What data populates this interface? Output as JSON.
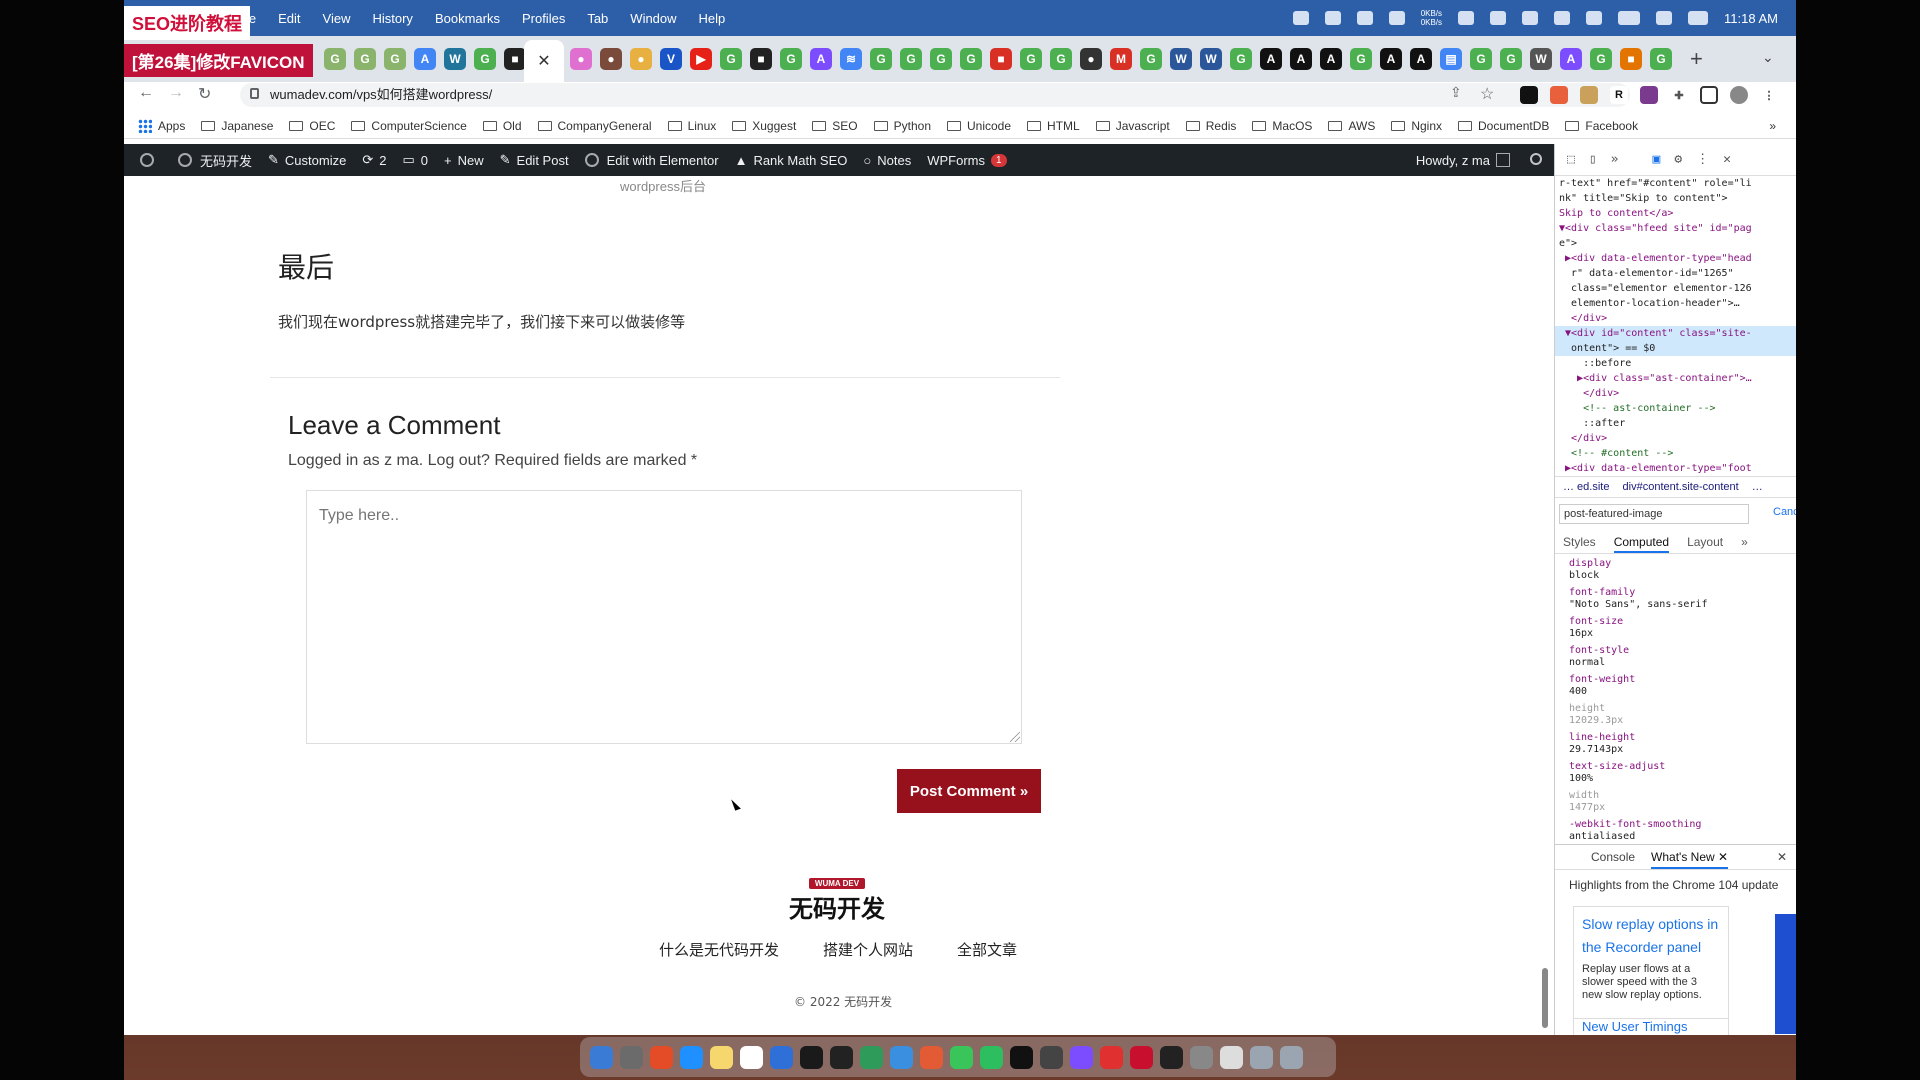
{
  "overlay": {
    "line1": "SEO进阶教程",
    "line2": "[第26集]修改FAVICON"
  },
  "menubar": {
    "items": [
      "le",
      "Edit",
      "View",
      "History",
      "Bookmarks",
      "Profiles",
      "Tab",
      "Window",
      "Help"
    ],
    "net_up": "0KB/s",
    "net_down": "0KB/s",
    "clock": "11:18 AM"
  },
  "tabs": {
    "close_glyph": "✕",
    "new_tab": "+",
    "menu": "⌄",
    "icons": [
      {
        "glyph": "G",
        "color": "#8ab36b"
      },
      {
        "glyph": "G",
        "color": "#8ab36b"
      },
      {
        "glyph": "G",
        "color": "#8ab36b"
      },
      {
        "glyph": "A",
        "color": "#4285f4"
      },
      {
        "glyph": "W",
        "color": "#21759b"
      },
      {
        "glyph": "G",
        "color": "#4caf50"
      },
      {
        "glyph": "■",
        "color": "#222"
      }
    ],
    "icons_right": [
      {
        "glyph": "●",
        "color": "#e070d0"
      },
      {
        "glyph": "●",
        "color": "#7a4a3a"
      },
      {
        "glyph": "●",
        "color": "#e8b040"
      },
      {
        "glyph": "V",
        "color": "#1a55c8"
      },
      {
        "glyph": "▶",
        "color": "#e62117"
      },
      {
        "glyph": "G",
        "color": "#4caf50"
      },
      {
        "glyph": "■",
        "color": "#222"
      },
      {
        "glyph": "G",
        "color": "#4caf50"
      },
      {
        "glyph": "A",
        "color": "#7c4dff"
      },
      {
        "glyph": "≋",
        "color": "#4285f4"
      },
      {
        "glyph": "G",
        "color": "#4caf50"
      },
      {
        "glyph": "G",
        "color": "#4caf50"
      },
      {
        "glyph": "G",
        "color": "#4caf50"
      },
      {
        "glyph": "G",
        "color": "#4caf50"
      },
      {
        "glyph": "■",
        "color": "#d93025"
      },
      {
        "glyph": "G",
        "color": "#4caf50"
      },
      {
        "glyph": "G",
        "color": "#4caf50"
      },
      {
        "glyph": "●",
        "color": "#333"
      },
      {
        "glyph": "M",
        "color": "#d93025"
      },
      {
        "glyph": "G",
        "color": "#4caf50"
      },
      {
        "glyph": "W",
        "color": "#2b579a"
      },
      {
        "glyph": "W",
        "color": "#2b579a"
      },
      {
        "glyph": "G",
        "color": "#4caf50"
      },
      {
        "glyph": "A",
        "color": "#111"
      },
      {
        "glyph": "A",
        "color": "#111"
      },
      {
        "glyph": "A",
        "color": "#111"
      },
      {
        "glyph": "G",
        "color": "#4caf50"
      },
      {
        "glyph": "A",
        "color": "#111"
      },
      {
        "glyph": "A",
        "color": "#111"
      },
      {
        "glyph": "▤",
        "color": "#4285f4"
      },
      {
        "glyph": "G",
        "color": "#4caf50"
      },
      {
        "glyph": "G",
        "color": "#4caf50"
      },
      {
        "glyph": "W",
        "color": "#555"
      },
      {
        "glyph": "A",
        "color": "#7c4dff"
      },
      {
        "glyph": "G",
        "color": "#4caf50"
      },
      {
        "glyph": "■",
        "color": "#e37400"
      },
      {
        "glyph": "G",
        "color": "#4caf50"
      }
    ]
  },
  "addressbar": {
    "back": "←",
    "forward": "→",
    "reload": "↻",
    "url": "wumadev.com/vps如何搭建wordpress/",
    "share": "⇪",
    "star": "☆",
    "ext_r": "R",
    "ext_puzzle": "✚",
    "ext_menu": "⋮"
  },
  "bookmarks": {
    "apps": "Apps",
    "folders": [
      "Japanese",
      "OEC",
      "ComputerScience",
      "Old",
      "CompanyGeneral",
      "Linux",
      "Xuggest",
      "SEO",
      "Python",
      "Unicode",
      "HTML",
      "Javascript",
      "Redis",
      "MacOS",
      "AWS",
      "Nginx",
      "DocumentDB",
      "Facebook"
    ],
    "more": "»"
  },
  "wpbar": {
    "site_name": "无码开发",
    "customize": "Customize",
    "updates_count": "2",
    "comments_count": "0",
    "new": "New",
    "edit_post": "Edit Post",
    "edit_elementor": "Edit with Elementor",
    "rank_math": "Rank Math SEO",
    "notes": "Notes",
    "wpforms": "WPForms",
    "wpforms_badge": "1",
    "howdy": "Howdy, z ma"
  },
  "article": {
    "caption_cut": "wordpress后台",
    "heading": "最后",
    "body": "我们现在wordpress就搭建完毕了，我们接下来可以做装修等"
  },
  "comments": {
    "title": "Leave a Comment",
    "logged_in": "Logged in as z ma. Log out? Required fields are marked *",
    "placeholder": "Type here..",
    "submit": "Post Comment »"
  },
  "footer": {
    "logo_tag": "WUMA DEV",
    "logo_text": "无码开发",
    "nav": [
      "什么是无代码开发",
      "搭建个人网站",
      "全部文章"
    ],
    "copyright": "© 2022 无码开发"
  },
  "devtools": {
    "dom_lines": [
      "r-text\" href=\"#content\" role=\"li",
      "nk\" title=\"Skip to content\">",
      "Skip to content</a>",
      "▼<div class=\"hfeed site\" id=\"pag",
      "e\">",
      " ▶<div data-elementor-type=\"head",
      "  r\" data-elementor-id=\"1265\"",
      "  class=\"elementor elementor-126",
      "  elementor-location-header\">…",
      "  </div>",
      " ▼<div id=\"content\" class=\"site-",
      "  ontent\"> == $0",
      "    ::before",
      "   ▶<div class=\"ast-container\">…",
      "    </div>",
      "    <!-- ast-container -->",
      "    ::after",
      "  </div>",
      "  <!-- #content -->",
      " ▶<div data-elementor-type=\"foot"
    ],
    "breadcrumb_1": "…  ed.site",
    "breadcrumb_2": "div#content.site-content",
    "breadcrumb_more": "…",
    "filter_value": "post-featured-image",
    "cancel": "Canc",
    "pane_tabs": [
      "Styles",
      "Computed",
      "Layout",
      "»"
    ],
    "computed": [
      {
        "name": "display",
        "value": "block",
        "dim": false
      },
      {
        "name": "font-family",
        "value": "\"Noto Sans\", sans-serif",
        "dim": false
      },
      {
        "name": "font-size",
        "value": "16px",
        "dim": false
      },
      {
        "name": "font-style",
        "value": "normal",
        "dim": false
      },
      {
        "name": "font-weight",
        "value": "400",
        "dim": false
      },
      {
        "name": "height",
        "value": "12029.3px",
        "dim": true
      },
      {
        "name": "line-height",
        "value": "29.7143px",
        "dim": false
      },
      {
        "name": "text-size-adjust",
        "value": "100%",
        "dim": false
      },
      {
        "name": "width",
        "value": "1477px",
        "dim": true
      },
      {
        "name": "-webkit-font-smoothing",
        "value": "antialiased",
        "dim": false
      }
    ],
    "drawer_tabs": [
      "Console",
      "What's New ✕"
    ],
    "drawer_close": "✕",
    "highlights": "Highlights from the Chrome 104 update",
    "card_title": "Slow replay options in the Recorder panel",
    "card_body": "Replay user flows at a slower speed with the 3 new slow replay options.",
    "card2_title": "New User Timings"
  },
  "dock": {
    "apps": [
      "#3a7bd5",
      "#6b6b6b",
      "#e34c26",
      "#1e90ff",
      "#f5d76e",
      "#ffffff",
      "#2f6fd8",
      "#1a1a1a",
      "#222",
      "#2e9b5b",
      "#3b8fe0",
      "#e25b35",
      "#3ac55a",
      "#2dbe60",
      "#111",
      "#444",
      "#7c4dff",
      "#e03030",
      "#c8102e",
      "#222",
      "#888",
      "#ddd",
      "#9aa5b1",
      "#9aa5b1"
    ]
  }
}
